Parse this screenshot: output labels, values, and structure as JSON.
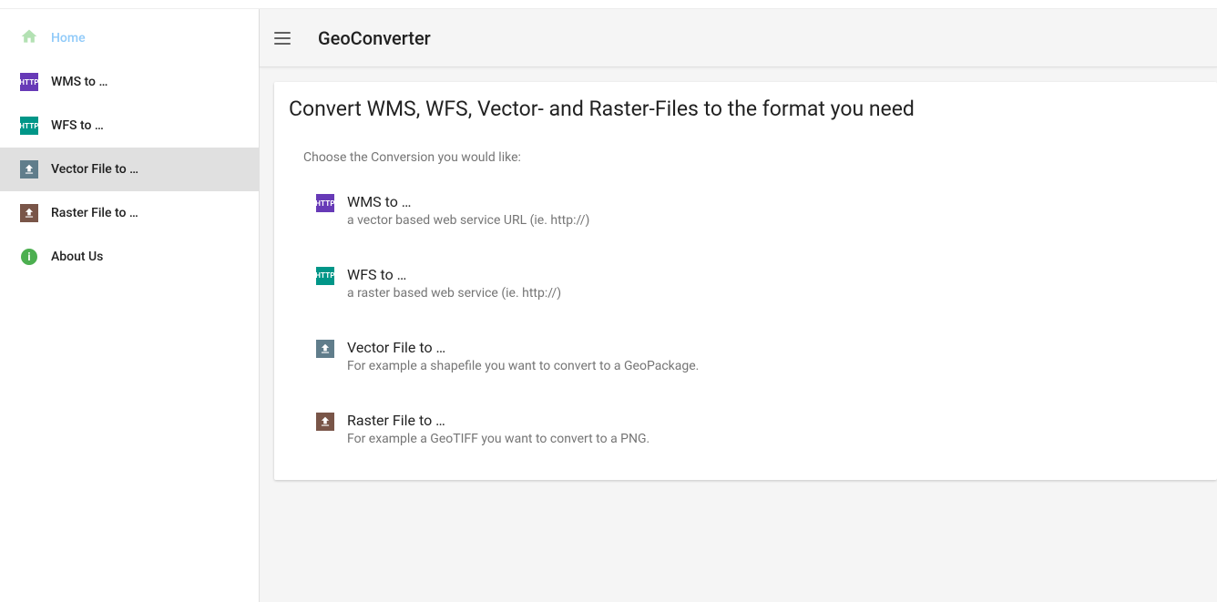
{
  "app_title": "GeoConverter",
  "sidebar": {
    "items": [
      {
        "label": "Home",
        "icon": "home",
        "state": "active"
      },
      {
        "label": "WMS to …",
        "icon": "http-purple"
      },
      {
        "label": "WFS to …",
        "icon": "http-teal"
      },
      {
        "label": "Vector File to …",
        "icon": "upload-gray",
        "state": "selected"
      },
      {
        "label": "Raster File to …",
        "icon": "upload-brown"
      },
      {
        "label": "About Us",
        "icon": "info"
      }
    ]
  },
  "main": {
    "heading": "Convert WMS, WFS, Vector- and Raster-Files to the format you need",
    "instruction": "Choose the Conversion you would like:",
    "options": [
      {
        "title": "WMS to …",
        "desc": "a vector based web service URL (ie. http://)",
        "icon": "http-purple"
      },
      {
        "title": "WFS to …",
        "desc": "a raster based web service (ie. http://)",
        "icon": "http-teal"
      },
      {
        "title": "Vector File to …",
        "desc": "For example a shapefile you want to convert to a GeoPackage.",
        "icon": "upload-gray"
      },
      {
        "title": "Raster File to …",
        "desc": "For example a GeoTIFF you want to convert to a PNG.",
        "icon": "upload-brown"
      }
    ]
  },
  "icon_http_text": "HTTP"
}
